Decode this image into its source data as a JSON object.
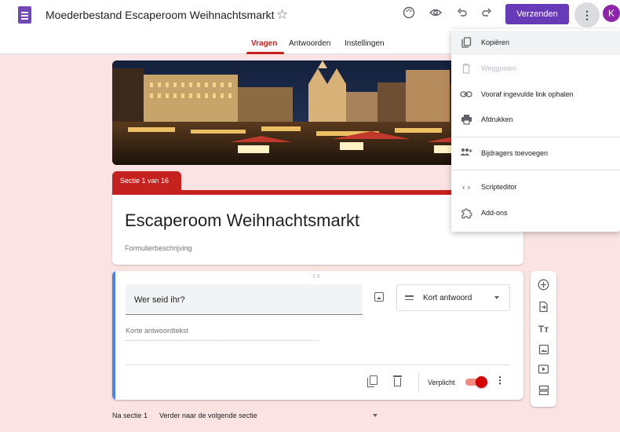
{
  "doc_title": "Moederbestand Escaperoom Weihnachtsmarkt",
  "topbar": {
    "send_label": "Verzenden",
    "avatar_initial": "K",
    "icons": [
      "palette-icon",
      "preview-icon",
      "undo-icon",
      "redo-icon",
      "more-vert-icon"
    ]
  },
  "tabs": [
    {
      "label": "Vragen",
      "active": true
    },
    {
      "label": "Antwoorden",
      "active": false
    },
    {
      "label": "Instellingen",
      "active": false
    }
  ],
  "section": {
    "tab_label": "Sectie 1 van 16",
    "form_title": "Escaperoom Weihnachtsmarkt",
    "form_description_placeholder": "Formulierbeschrijving"
  },
  "question": {
    "title": "Wer seid ihr?",
    "type_label": "Kort antwoord",
    "answer_hint": "Korte antwoordtekst",
    "required_label": "Verplicht",
    "required": true
  },
  "footer": {
    "after_section_label": "Na sectie 1",
    "after_section_value": "Verder naar de volgende sectie"
  },
  "menu": {
    "items": [
      {
        "label": "Kopiëren",
        "icon": "copy-icon",
        "disabled": false
      },
      {
        "label": "Weggooien",
        "icon": "trash-icon",
        "disabled": true
      },
      {
        "label": "Vooraf ingevulde link ophalen",
        "icon": "link-icon",
        "disabled": false
      },
      {
        "label": "Afdrukken",
        "icon": "print-icon",
        "disabled": false
      },
      {
        "label": "Bijdragers toevoegen",
        "icon": "add-people-icon",
        "disabled": false
      },
      {
        "label": "Scripteditor",
        "icon": "code-icon",
        "disabled": false
      },
      {
        "label": "Add-ons",
        "icon": "puzzle-icon",
        "disabled": false
      }
    ]
  },
  "colors": {
    "theme": "#c5221f",
    "background": "#fbe3e3",
    "send_button": "#673ab7",
    "accent_focus": "#4285f4"
  }
}
